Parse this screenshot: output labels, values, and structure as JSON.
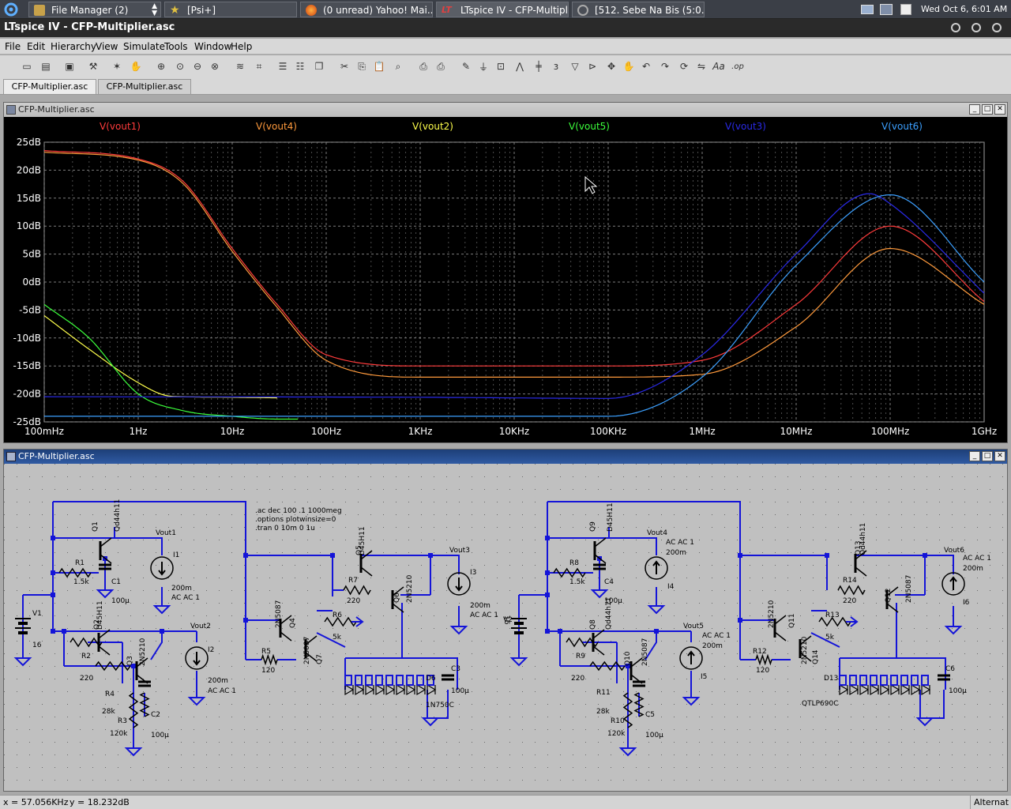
{
  "taskbar": {
    "items": [
      {
        "label": "File Manager (2)"
      },
      {
        "label": "[Psi+]"
      },
      {
        "label": "(0 unread) Yahoo! Mai..."
      },
      {
        "label": "LTspice IV - CFP-Multipl..."
      },
      {
        "label": "[512. Sebe Na Bis (5:0..."
      }
    ],
    "clock": "Wed Oct  6,  6:01 AM"
  },
  "app": {
    "title": "LTspice IV - CFP-Multiplier.asc"
  },
  "menu": [
    "File",
    "Edit",
    "Hierarchy",
    "View",
    "Simulate",
    "Tools",
    "Window",
    "Help"
  ],
  "tabs": [
    "CFP-Multiplier.asc",
    "CFP-Multiplier.asc"
  ],
  "plot_window": {
    "title": "CFP-Multiplier.asc"
  },
  "schematic_window": {
    "title": "CFP-Multiplier.asc"
  },
  "status": {
    "x": "x = 57.056KHz",
    "y": "y = 18.232dB",
    "right": "Alternat"
  },
  "colors": {
    "vout1": "#ff3b3b",
    "vout4": "#ff9a3c",
    "vout2": "#ffff4c",
    "vout5": "#3cff3c",
    "vout3": "#2a2ae8",
    "vout6": "#3ca0ff",
    "wire": "#1414d8",
    "plot_bg": "#000000"
  },
  "chart_data": {
    "type": "line",
    "xscale": "log",
    "xlim": [
      0.1,
      1000000000
    ],
    "ylim": [
      -25,
      25
    ],
    "grid": true,
    "xticks": [
      "100mHz",
      "1Hz",
      "10Hz",
      "100Hz",
      "1KHz",
      "10KHz",
      "100KHz",
      "1MHz",
      "10MHz",
      "100MHz",
      "1GHz"
    ],
    "yticks": [
      "25dB",
      "20dB",
      "15dB",
      "10dB",
      "5dB",
      "0dB",
      "-5dB",
      "-10dB",
      "-15dB",
      "-20dB",
      "-25dB"
    ],
    "series": [
      {
        "name": "V(vout1)",
        "color": "#ff3b3b",
        "x": [
          0.1,
          1,
          3,
          10,
          30,
          100,
          1000,
          100000,
          1000000,
          10000000,
          100000000,
          1000000000
        ],
        "y": [
          23.5,
          22,
          18,
          6,
          -4,
          -13,
          -15,
          -15,
          -14,
          -4,
          10,
          -3.5
        ]
      },
      {
        "name": "V(vout4)",
        "color": "#ff9a3c",
        "x": [
          0.1,
          1,
          3,
          10,
          30,
          100,
          1000,
          100000,
          1000000,
          10000000,
          100000000,
          1000000000
        ],
        "y": [
          23.2,
          21.8,
          17.6,
          5.5,
          -4.5,
          -14,
          -17,
          -17,
          -16.5,
          -8,
          6,
          -4
        ]
      },
      {
        "name": "V(vout2)",
        "color": "#ffff4c",
        "x": [
          0.1,
          0.3,
          1,
          2,
          3,
          10,
          30
        ],
        "y": [
          -6,
          -12,
          -18,
          -20.3,
          -20.5,
          -20.6,
          -20.7
        ]
      },
      {
        "name": "V(vout5)",
        "color": "#3cff3c",
        "x": [
          0.1,
          0.3,
          1,
          3,
          10,
          30,
          50
        ],
        "y": [
          -4,
          -10,
          -20,
          -23,
          -24,
          -24.5,
          -24.5
        ]
      },
      {
        "name": "V(vout3)",
        "color": "#2a2ae8",
        "x": [
          0.1,
          1000,
          100000,
          1000000,
          10000000,
          60000000,
          100000000,
          1000000000
        ],
        "y": [
          -20.5,
          -20.6,
          -20.8,
          -13,
          5,
          15.8,
          14,
          -2
        ]
      },
      {
        "name": "V(vout6)",
        "color": "#3ca0ff",
        "x": [
          0.1,
          1000,
          100000,
          1000000,
          10000000,
          100000000,
          1000000000
        ],
        "y": [
          -24,
          -24,
          -24,
          -17,
          3,
          15.6,
          0
        ]
      }
    ]
  },
  "schematic": {
    "directives": [
      ".ac dec 100 .1 1000meg",
      ".options plotwinsize=0",
      ".tran 0 10m 0 1u"
    ],
    "labels": [
      {
        "text": "Q1"
      },
      {
        "text": "Qd44h11"
      },
      {
        "text": "R1"
      },
      {
        "text": "1.5k"
      },
      {
        "text": "C1"
      },
      {
        "text": "100µ"
      },
      {
        "text": "Vout1"
      },
      {
        "text": "I1"
      },
      {
        "text": "200m"
      },
      {
        "text": "AC AC 1"
      },
      {
        "text": "V1"
      },
      {
        "text": "16"
      },
      {
        "text": "Q2"
      },
      {
        "text": "D45H11"
      },
      {
        "text": "R2"
      },
      {
        "text": "220"
      },
      {
        "text": "Q3"
      },
      {
        "text": "2N5210"
      },
      {
        "text": "R4"
      },
      {
        "text": "28k"
      },
      {
        "text": "R3"
      },
      {
        "text": "120k"
      },
      {
        "text": "C2"
      },
      {
        "text": "100µ"
      },
      {
        "text": "Vout2"
      },
      {
        "text": "I2"
      },
      {
        "text": "200m"
      },
      {
        "text": "AC AC 1"
      },
      {
        "text": "Q5"
      },
      {
        "text": "D45H11"
      },
      {
        "text": "R7"
      },
      {
        "text": "220"
      },
      {
        "text": "Q6"
      },
      {
        "text": "2N5210"
      },
      {
        "text": "Vout3"
      },
      {
        "text": "I3"
      },
      {
        "text": "200m"
      },
      {
        "text": "AC AC 1"
      },
      {
        "text": "Q4"
      },
      {
        "text": "2N5087"
      },
      {
        "text": "R6"
      },
      {
        "text": "5k"
      },
      {
        "text": "R5"
      },
      {
        "text": "120"
      },
      {
        "text": "Q7"
      },
      {
        "text": "2N5087"
      },
      {
        "text": "D6"
      },
      {
        "text": "C3"
      },
      {
        "text": "100µ"
      },
      {
        "text": "1N750C"
      },
      {
        "text": "Q9"
      },
      {
        "text": "D45H11"
      },
      {
        "text": "R8"
      },
      {
        "text": "1.5k"
      },
      {
        "text": "C4"
      },
      {
        "text": "100µ"
      },
      {
        "text": "Vout4"
      },
      {
        "text": "AC AC 1"
      },
      {
        "text": "200m"
      },
      {
        "text": "I4"
      },
      {
        "text": "V2"
      },
      {
        "text": "16"
      },
      {
        "text": "Q8"
      },
      {
        "text": "Qd44h11"
      },
      {
        "text": "R9"
      },
      {
        "text": "220"
      },
      {
        "text": "Q10"
      },
      {
        "text": "2N5087"
      },
      {
        "text": "R11"
      },
      {
        "text": "28k"
      },
      {
        "text": "R10"
      },
      {
        "text": "120k"
      },
      {
        "text": "C5"
      },
      {
        "text": "100µ"
      },
      {
        "text": "Vout5"
      },
      {
        "text": "AC AC 1"
      },
      {
        "text": "200m"
      },
      {
        "text": "I5"
      },
      {
        "text": "Q13"
      },
      {
        "text": "Qd44h11"
      },
      {
        "text": "R14"
      },
      {
        "text": "220"
      },
      {
        "text": "Q12"
      },
      {
        "text": "2N5087"
      },
      {
        "text": "Vout6"
      },
      {
        "text": "AC AC 1"
      },
      {
        "text": "200m"
      },
      {
        "text": "I6"
      },
      {
        "text": "Q11"
      },
      {
        "text": "2N5210"
      },
      {
        "text": "R13"
      },
      {
        "text": "5k"
      },
      {
        "text": "R12"
      },
      {
        "text": "120"
      },
      {
        "text": "Q14"
      },
      {
        "text": "2N5210"
      },
      {
        "text": "D13"
      },
      {
        "text": "C6"
      },
      {
        "text": "100µ"
      },
      {
        "text": "QTLP690C"
      }
    ]
  }
}
